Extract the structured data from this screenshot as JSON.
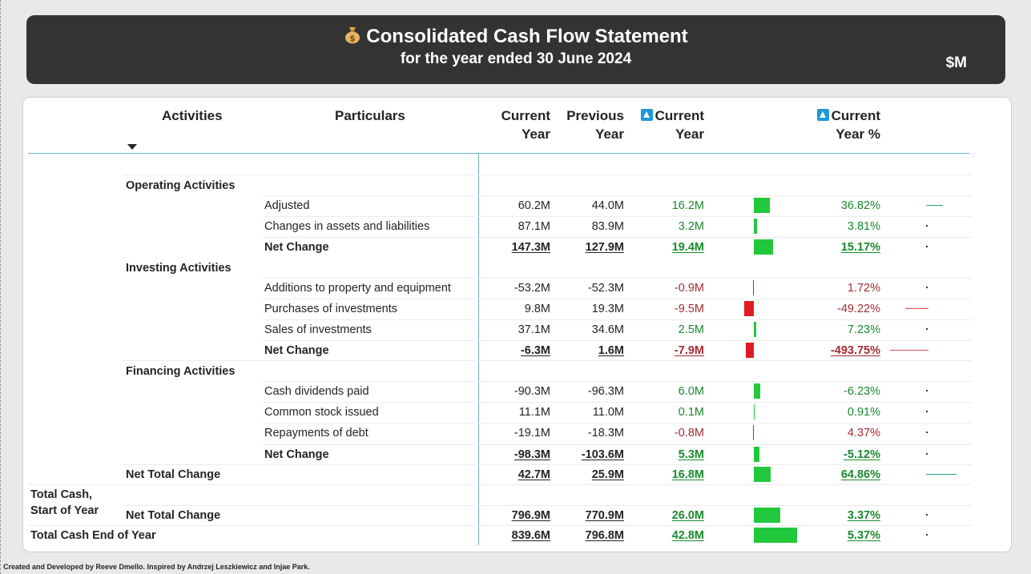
{
  "header": {
    "title": "Consolidated Cash Flow Statement",
    "subtitle": "for the year ended 30 June 2024",
    "unit": "$M",
    "title_icon": "money-bag-icon"
  },
  "table": {
    "columns": {
      "activities": "Activities",
      "particulars": "Particulars",
      "current_year_1": "Current",
      "current_year_2": "Year",
      "previous_year_1": "Previous",
      "previous_year_2": "Year",
      "delta_1": "Current",
      "delta_2": "Year",
      "delta_pct_1": "Current",
      "delta_pct_2": "Year %"
    },
    "sections": {
      "operating": "Operating Activities",
      "investing": "Investing Activities",
      "financing": "Financing Activities",
      "net_total": "Net Total Change",
      "total_start_1": "Total Cash,",
      "total_start_2": "Start of Year",
      "total_start_sub": "Net Total Change",
      "total_end": "Total Cash End of Year"
    },
    "rows": [
      {
        "particular": "Adjusted",
        "cy": "60.2M",
        "py": "44.0M",
        "delta": "16.2M",
        "pct": "36.82%",
        "sign": "pos",
        "delta_value": 16.2,
        "pct_value": 36.82
      },
      {
        "particular": "Changes in assets and liabilities",
        "cy": "87.1M",
        "py": "83.9M",
        "delta": "3.2M",
        "pct": "3.81%",
        "sign": "pos",
        "delta_value": 3.2,
        "pct_value": 3.81
      },
      {
        "particular": "Net Change",
        "cy": "147.3M",
        "py": "127.9M",
        "delta": "19.4M",
        "pct": "15.17%",
        "sign": "pos",
        "delta_value": 19.4,
        "pct_value": 15.17
      },
      {
        "particular": "Additions to property and equipment",
        "cy": "-53.2M",
        "py": "-52.3M",
        "delta": "-0.9M",
        "pct": "1.72%",
        "sign": "neg",
        "delta_value": -0.9,
        "pct_value": 1.72
      },
      {
        "particular": "Purchases of investments",
        "cy": "9.8M",
        "py": "19.3M",
        "delta": "-9.5M",
        "pct": "-49.22%",
        "sign": "neg",
        "delta_value": -9.5,
        "pct_value": -49.22
      },
      {
        "particular": "Sales of investments",
        "cy": "37.1M",
        "py": "34.6M",
        "delta": "2.5M",
        "pct": "7.23%",
        "sign": "pos",
        "delta_value": 2.5,
        "pct_value": 7.23
      },
      {
        "particular": "Net Change",
        "cy": "-6.3M",
        "py": "1.6M",
        "delta": "-7.9M",
        "pct": "-493.75%",
        "sign": "neg",
        "delta_value": -7.9,
        "pct_value": -493.75
      },
      {
        "particular": "Cash dividends paid",
        "cy": "-90.3M",
        "py": "-96.3M",
        "delta": "6.0M",
        "pct": "-6.23%",
        "sign": "pos",
        "delta_value": 6.0,
        "pct_value": -6.23
      },
      {
        "particular": "Common stock issued",
        "cy": "11.1M",
        "py": "11.0M",
        "delta": "0.1M",
        "pct": "0.91%",
        "sign": "pos",
        "delta_value": 0.1,
        "pct_value": 0.91
      },
      {
        "particular": "Repayments of debt",
        "cy": "-19.1M",
        "py": "-18.3M",
        "delta": "-0.8M",
        "pct": "4.37%",
        "sign": "neg",
        "delta_value": -0.8,
        "pct_value": 4.37
      },
      {
        "particular": "Net Change",
        "cy": "-98.3M",
        "py": "-103.6M",
        "delta": "5.3M",
        "pct": "-5.12%",
        "sign": "pos",
        "delta_value": 5.3,
        "pct_value": -5.12
      },
      {
        "particular": "",
        "cy": "42.7M",
        "py": "25.9M",
        "delta": "16.8M",
        "pct": "64.86%",
        "sign": "pos",
        "delta_value": 16.8,
        "pct_value": 64.86
      },
      {
        "particular": "",
        "cy": "796.9M",
        "py": "770.9M",
        "delta": "26.0M",
        "pct": "3.37%",
        "sign": "pos",
        "delta_value": 26.0,
        "pct_value": 3.37
      },
      {
        "particular": "",
        "cy": "839.6M",
        "py": "796.8M",
        "delta": "42.8M",
        "pct": "5.37%",
        "sign": "pos",
        "delta_value": 42.8,
        "pct_value": 5.37
      }
    ]
  },
  "colors": {
    "positive": "#1a8a2e",
    "negative": "#a42c34",
    "bar_positive": "#21c83c",
    "bar_negative": "#e01b24",
    "accent": "#1d9ad6",
    "header_bg": "#333333"
  },
  "footer": {
    "credit": "Created and Developed by Reeve Dmello. Inspired by Andrzej Leszkiewicz and Injae Park."
  }
}
